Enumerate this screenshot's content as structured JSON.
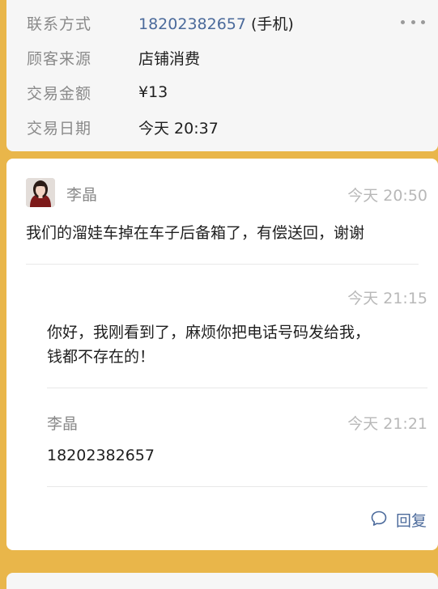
{
  "contact_info": {
    "rows": [
      {
        "label": "联系方式",
        "value": "18202382657",
        "suffix": " (手机)"
      },
      {
        "label": "顾客来源",
        "value": "店铺消费"
      },
      {
        "label": "交易金额",
        "value": "¥13"
      },
      {
        "label": "交易日期",
        "value": "今天 20:37"
      }
    ],
    "more_icon": "more-horizontal-icon"
  },
  "comment": {
    "author": "李晶",
    "time": "今天 20:50",
    "text": "我们的溜娃车掉在车子后备箱了，有偿送回，谢谢"
  },
  "merchant_reply": {
    "time": "今天 21:15",
    "lines": [
      "你好，我刚看到了，麻烦你把电话号码发给我，",
      "钱都不存在的！"
    ]
  },
  "customer_reply": {
    "author": "李晶",
    "time": "今天 21:21",
    "text": "18202382657"
  },
  "actions": {
    "reply_label": "回复",
    "reply_icon": "comment-bubble-icon"
  },
  "colors": {
    "background": "#e9b64a",
    "link": "#4b6a9b",
    "muted": "#8a8a8a",
    "time": "#b8b8b8"
  }
}
